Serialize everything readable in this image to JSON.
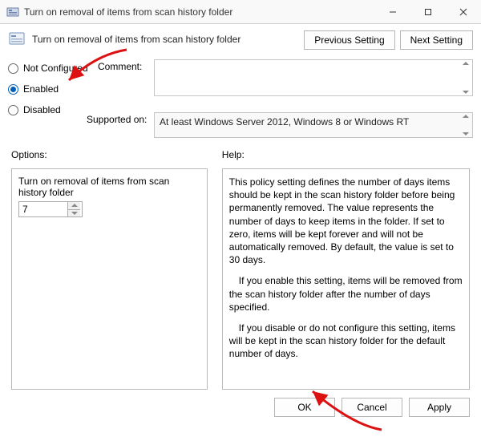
{
  "window": {
    "title": "Turn on removal of items from scan history folder"
  },
  "header": {
    "policy_title": "Turn on removal of items from scan history folder",
    "buttons": {
      "previous": "Previous Setting",
      "next": "Next Setting"
    }
  },
  "state": {
    "not_configured": "Not Configured",
    "enabled": "Enabled",
    "disabled": "Disabled",
    "selected": "enabled"
  },
  "comment": {
    "label": "Comment:",
    "value": ""
  },
  "supported": {
    "label": "Supported on:",
    "value": "At least Windows Server 2012, Windows 8 or Windows RT"
  },
  "columns": {
    "options_label": "Options:",
    "help_label": "Help:"
  },
  "options": {
    "option_title": "Turn on removal of items from scan history folder",
    "days_value": "7"
  },
  "help": {
    "p1": "This policy setting defines the number of days items should be kept in the scan history folder before being permanently removed. The value represents the number of days to keep items in the folder. If set to zero, items will be kept forever and will not be automatically removed. By default, the value is set to 30 days.",
    "p2": "If you enable this setting, items will be removed from the scan history folder after the number of days specified.",
    "p3": "If you disable or do not configure this setting, items will be kept in the scan history folder for the default number of days."
  },
  "footer": {
    "ok": "OK",
    "cancel": "Cancel",
    "apply": "Apply"
  }
}
